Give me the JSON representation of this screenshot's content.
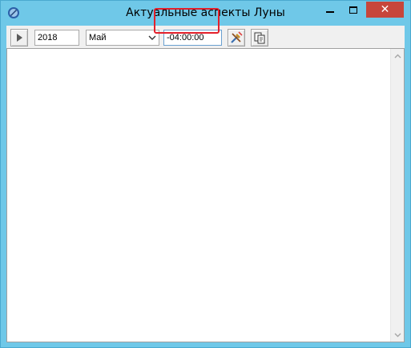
{
  "window": {
    "title": "Актуальные аспекты Луны",
    "close_glyph": "✕",
    "icons": {
      "app": "app-globe-icon",
      "minimize": "minimize-icon",
      "maximize": "maximize-icon",
      "close": "close-icon"
    }
  },
  "toolbar": {
    "year": "2018",
    "month": "Май",
    "time_offset": "-04:00:00",
    "icons": {
      "play": "play-icon",
      "tools": "tools-icon",
      "copy": "copy-icon",
      "dropdown": "chevron-down-icon"
    }
  },
  "colors": {
    "titlebar": "#6fc8e8",
    "close_button": "#c7463b",
    "highlight": "#e3202b"
  }
}
